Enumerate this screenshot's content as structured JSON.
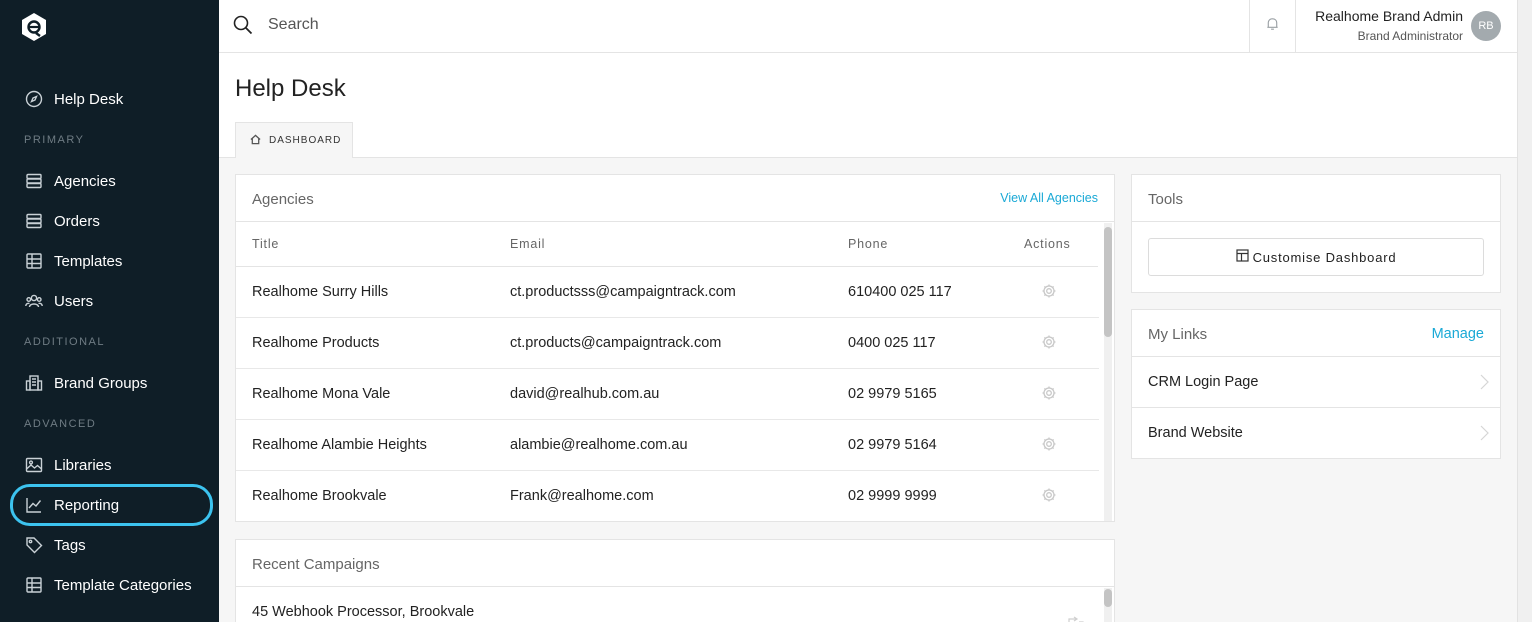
{
  "sidebar": {
    "items": [
      {
        "label": "Help Desk",
        "icon": "compass-icon"
      },
      {
        "label": "Agencies",
        "icon": "stack-icon"
      },
      {
        "label": "Orders",
        "icon": "stack-icon"
      },
      {
        "label": "Templates",
        "icon": "grid-icon"
      },
      {
        "label": "Users",
        "icon": "users-icon"
      },
      {
        "label": "Brand Groups",
        "icon": "building-icon"
      },
      {
        "label": "Libraries",
        "icon": "image-icon"
      },
      {
        "label": "Reporting",
        "icon": "chart-line-icon"
      },
      {
        "label": "Tags",
        "icon": "tag-icon"
      },
      {
        "label": "Template Categories",
        "icon": "grid-icon"
      }
    ],
    "sections": {
      "primary": "PRIMARY",
      "additional": "ADDITIONAL",
      "advanced": "ADVANCED"
    }
  },
  "topbar": {
    "search_placeholder": "Search",
    "user_name": "Realhome Brand Admin",
    "user_role": "Brand Administrator",
    "avatar_initials": "RB"
  },
  "page": {
    "title": "Help Desk",
    "tab": "DASHBOARD"
  },
  "agencies": {
    "title": "Agencies",
    "view_all": "View All Agencies",
    "columns": [
      "Title",
      "Email",
      "Phone",
      "Actions"
    ],
    "rows": [
      {
        "title": "Realhome Surry Hills",
        "email": "ct.productsss@campaigntrack.com",
        "phone": "610400 025 117"
      },
      {
        "title": "Realhome Products",
        "email": "ct.products@campaigntrack.com",
        "phone": "0400 025 117"
      },
      {
        "title": "Realhome Mona Vale",
        "email": "david@realhub.com.au",
        "phone": "02 9979 5165"
      },
      {
        "title": "Realhome Alambie Heights",
        "email": "alambie@realhome.com.au",
        "phone": "02 9979 5164"
      },
      {
        "title": "Realhome Brookvale",
        "email": "Frank@realhome.com",
        "phone": "02 9999 9999"
      }
    ]
  },
  "campaigns": {
    "title": "Recent Campaigns",
    "rows": [
      {
        "title": "45 Webhook Processor, Brookvale"
      }
    ]
  },
  "tools": {
    "title": "Tools",
    "customise_label": "Customise Dashboard"
  },
  "my_links": {
    "title": "My Links",
    "manage": "Manage",
    "items": [
      "CRM Login Page",
      "Brand Website"
    ]
  },
  "colors": {
    "sidebar_bg": "#0f1e27",
    "accent": "#1aa9d6",
    "highlight_ring": "#3cc3ef"
  }
}
